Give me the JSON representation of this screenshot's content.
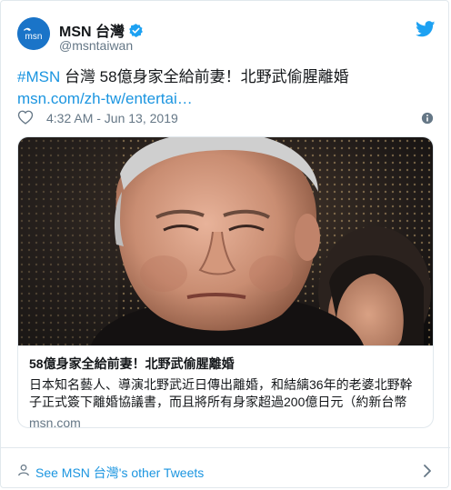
{
  "account": {
    "display_name": "MSN 台灣",
    "handle": "@msntaiwan",
    "avatar_text": "msn"
  },
  "tweet": {
    "hashtag": "#MSN",
    "text_main": " 台灣 58億身家全給前妻！北野武偷腥離婚 ",
    "link": "msn.com/zh-tw/entertai…",
    "timestamp": "4:32 AM - Jun 13, 2019"
  },
  "link_card": {
    "title": "58億身家全給前妻！北野武偷腥離婚",
    "description": "日本知名藝人、導演北野武近日傳出離婚，和結縭36年的老婆北野幹子正式簽下離婚協議書，而且將所有身家超過200億日元（約新台幣",
    "domain": "msn.com"
  },
  "footer": {
    "link_label": "See MSN 台灣's other Tweets"
  },
  "colors": {
    "link_blue": "#1b95e0",
    "gray_text": "#657786",
    "border": "#e1e8ed",
    "avatar_bg": "#1a74c8"
  },
  "icons": [
    "msn-avatar-icon",
    "verified-badge-icon",
    "twitter-bird-icon",
    "heart-icon",
    "info-icon",
    "person-icon",
    "chevron-right-icon"
  ]
}
